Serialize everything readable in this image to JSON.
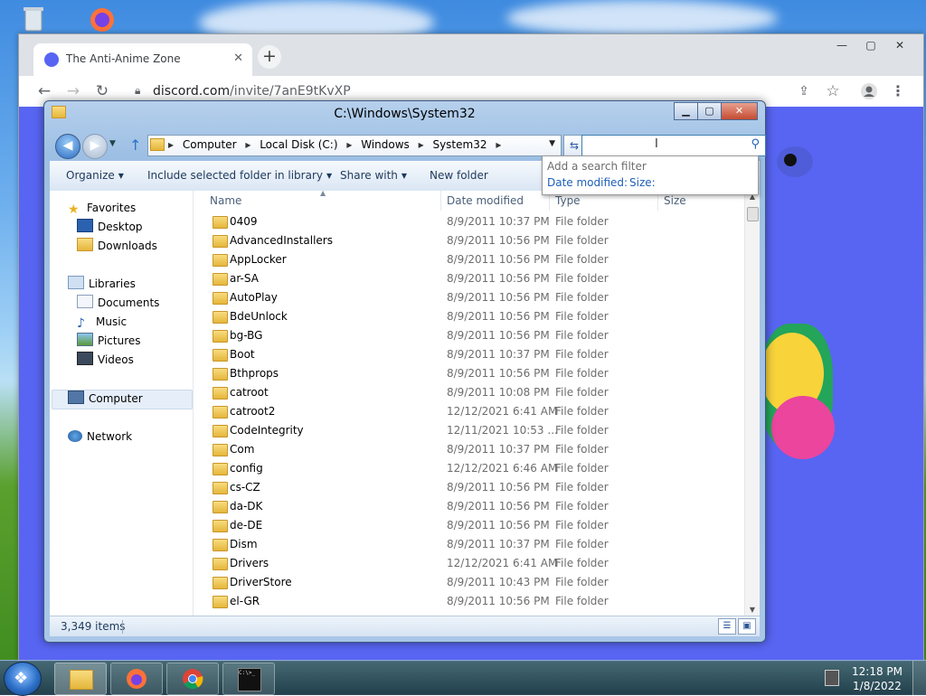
{
  "browser": {
    "tab_title": "The Anti-Anime Zone",
    "tab_close": "✕",
    "new_tab": "+",
    "url_domain": "discord.com",
    "url_path": "/invite/7anE9tKvXP",
    "minimize": "—",
    "maximize": "▢",
    "close": "✕"
  },
  "explorer": {
    "title": "C:\\Windows\\System32",
    "breadcrumbs": [
      "Computer",
      "Local Disk (C:)",
      "Windows",
      "System32"
    ],
    "search_placeholder": "",
    "filter_popup": {
      "hint": "Add a search filter",
      "options": [
        "Date modified:",
        "Size:"
      ]
    },
    "commands": {
      "organize": "Organize",
      "include": "Include selected folder in library",
      "share": "Share with",
      "newfolder": "New folder"
    },
    "nav": {
      "favorites": "Favorites",
      "desktop": "Desktop",
      "downloads": "Downloads",
      "libraries": "Libraries",
      "documents": "Documents",
      "music": "Music",
      "pictures": "Pictures",
      "videos": "Videos",
      "computer": "Computer",
      "network": "Network"
    },
    "columns": {
      "name": "Name",
      "date": "Date modified",
      "type": "Type",
      "size": "Size"
    },
    "files": [
      {
        "name": "0409",
        "date": "8/9/2011 10:37 PM",
        "type": "File folder"
      },
      {
        "name": "AdvancedInstallers",
        "date": "8/9/2011 10:56 PM",
        "type": "File folder"
      },
      {
        "name": "AppLocker",
        "date": "8/9/2011 10:56 PM",
        "type": "File folder"
      },
      {
        "name": "ar-SA",
        "date": "8/9/2011 10:56 PM",
        "type": "File folder"
      },
      {
        "name": "AutoPlay",
        "date": "8/9/2011 10:56 PM",
        "type": "File folder"
      },
      {
        "name": "BdeUnlock",
        "date": "8/9/2011 10:56 PM",
        "type": "File folder"
      },
      {
        "name": "bg-BG",
        "date": "8/9/2011 10:56 PM",
        "type": "File folder"
      },
      {
        "name": "Boot",
        "date": "8/9/2011 10:37 PM",
        "type": "File folder"
      },
      {
        "name": "Bthprops",
        "date": "8/9/2011 10:56 PM",
        "type": "File folder"
      },
      {
        "name": "catroot",
        "date": "8/9/2011 10:08 PM",
        "type": "File folder"
      },
      {
        "name": "catroot2",
        "date": "12/12/2021 6:41 AM",
        "type": "File folder"
      },
      {
        "name": "CodeIntegrity",
        "date": "12/11/2021 10:53 ...",
        "type": "File folder"
      },
      {
        "name": "Com",
        "date": "8/9/2011 10:37 PM",
        "type": "File folder"
      },
      {
        "name": "config",
        "date": "12/12/2021 6:46 AM",
        "type": "File folder"
      },
      {
        "name": "cs-CZ",
        "date": "8/9/2011 10:56 PM",
        "type": "File folder"
      },
      {
        "name": "da-DK",
        "date": "8/9/2011 10:56 PM",
        "type": "File folder"
      },
      {
        "name": "de-DE",
        "date": "8/9/2011 10:56 PM",
        "type": "File folder"
      },
      {
        "name": "Dism",
        "date": "8/9/2011 10:37 PM",
        "type": "File folder"
      },
      {
        "name": "Drivers",
        "date": "12/12/2021 6:41 AM",
        "type": "File folder"
      },
      {
        "name": "DriverStore",
        "date": "8/9/2011 10:43 PM",
        "type": "File folder"
      },
      {
        "name": "el-GR",
        "date": "8/9/2011 10:56 PM",
        "type": "File folder"
      }
    ],
    "status_count": "3,349 items"
  },
  "taskbar": {
    "time": "12:18 PM",
    "date": "1/8/2022",
    "cmd_label": "C:\\>_"
  },
  "colors": {
    "discord_blurple": "#5865f2",
    "folder_yellow": "#e5b63b",
    "link_blue": "#1e5ebb"
  }
}
